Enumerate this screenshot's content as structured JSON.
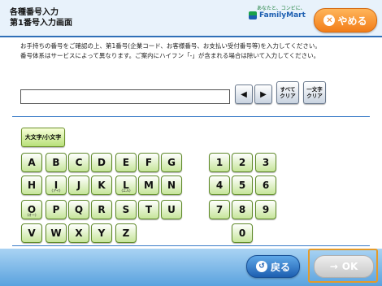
{
  "header": {
    "title_line1": "各種番号入力",
    "title_line2": "第1番号入力画面",
    "brand_tagline": "あなたと、コンビに、",
    "brand_name": "FamilyMart",
    "quit_label": "やめる"
  },
  "instructions": {
    "line1": "お手持ちの番号をご確認の上、第1番号(企業コード、お客様番号、お支払い受付番号等)を入力してください。",
    "line2": "番号体系はサービスによって異なります。ご案内にハイフン「-」が含まれる場合は除いて入力してください。"
  },
  "input": {
    "value": ""
  },
  "controls": {
    "left": "◀",
    "right": "▶",
    "clear_all": [
      "すべて",
      "クリア"
    ],
    "clear_one": [
      "一文字",
      "クリア"
    ]
  },
  "case_toggle": "大文字/小文字",
  "letters": [
    {
      "k": "A"
    },
    {
      "k": "B"
    },
    {
      "k": "C"
    },
    {
      "k": "D"
    },
    {
      "k": "E"
    },
    {
      "k": "F"
    },
    {
      "k": "G"
    },
    {
      "k": "H"
    },
    {
      "k": "I",
      "s": "(アイ)"
    },
    {
      "k": "J"
    },
    {
      "k": "K"
    },
    {
      "k": "L",
      "s": "(エル)"
    },
    {
      "k": "M"
    },
    {
      "k": "N"
    },
    {
      "k": "O",
      "s": "(オー)"
    },
    {
      "k": "P"
    },
    {
      "k": "Q"
    },
    {
      "k": "R"
    },
    {
      "k": "S"
    },
    {
      "k": "T"
    },
    {
      "k": "U"
    },
    {
      "k": "V"
    },
    {
      "k": "W"
    },
    {
      "k": "X"
    },
    {
      "k": "Y"
    },
    {
      "k": "Z"
    }
  ],
  "digits": [
    "1",
    "2",
    "3",
    "4",
    "5",
    "6",
    "7",
    "8",
    "9",
    "0"
  ],
  "footer": {
    "back_label": "戻る",
    "ok_label": "OK",
    "ok_arrow": "→"
  },
  "colors": {
    "header_bg": "#e8f2fb",
    "quit": "#f27d18",
    "key_green": "#c6e59a",
    "back_blue": "#1d5fb1",
    "ok_disabled": "#c8c8c8"
  }
}
